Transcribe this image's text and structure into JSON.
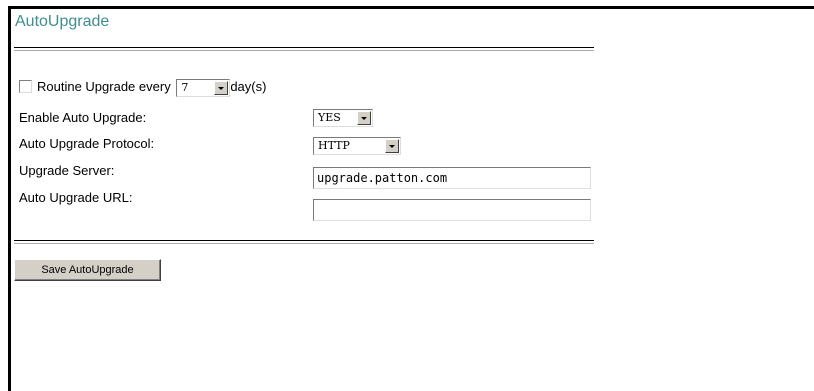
{
  "page": {
    "title": "AutoUpgrade"
  },
  "routine": {
    "checked": false,
    "prefix": "Routine Upgrade every",
    "days_value": "7",
    "suffix": "day(s)"
  },
  "fields": {
    "enable_label": "Enable Auto Upgrade:",
    "enable_value": "YES",
    "protocol_label": "Auto Upgrade Protocol:",
    "protocol_value": "HTTP",
    "server_label": "Upgrade Server:",
    "server_value": "upgrade.patton.com",
    "url_label": "Auto Upgrade URL:",
    "url_value": ""
  },
  "actions": {
    "save_label": "Save AutoUpgrade"
  },
  "colors": {
    "title": "#3f8f8f",
    "button_face": "#d4d0c8"
  }
}
